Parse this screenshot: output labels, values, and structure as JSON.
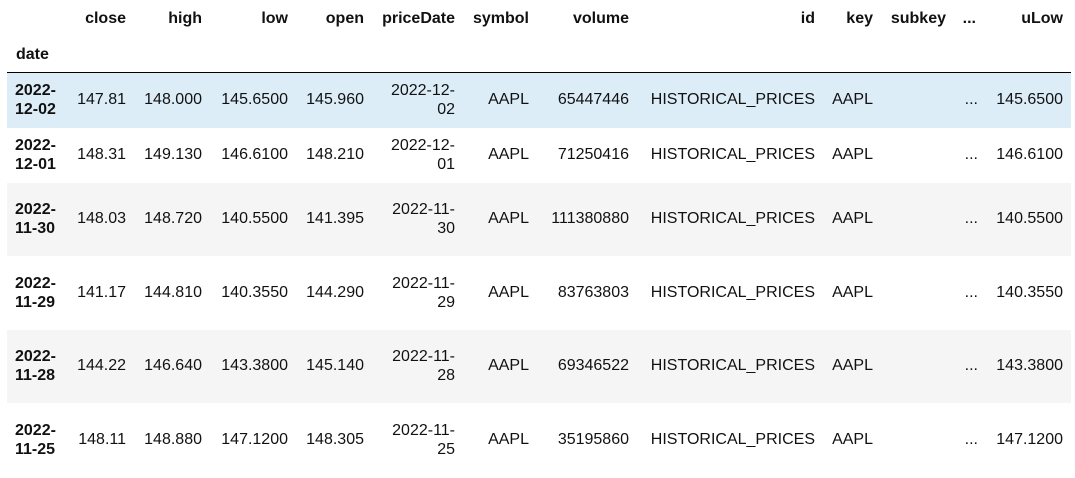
{
  "columns": [
    "close",
    "high",
    "low",
    "open",
    "priceDate",
    "symbol",
    "volume",
    "id",
    "key",
    "subkey",
    "...",
    "uLow"
  ],
  "index_name": "date",
  "rows": [
    {
      "date": "2022-12-02",
      "close": "147.81",
      "high": "148.000",
      "low": "145.6500",
      "open": "145.960",
      "priceDate": "2022-12-02",
      "symbol": "AAPL",
      "volume": "65447446",
      "id": "HISTORICAL_PRICES",
      "key": "AAPL",
      "subkey": "",
      "dots": "...",
      "uLow": "145.6500"
    },
    {
      "date": "2022-12-01",
      "close": "148.31",
      "high": "149.130",
      "low": "146.6100",
      "open": "148.210",
      "priceDate": "2022-12-01",
      "symbol": "AAPL",
      "volume": "71250416",
      "id": "HISTORICAL_PRICES",
      "key": "AAPL",
      "subkey": "",
      "dots": "...",
      "uLow": "146.6100"
    },
    {
      "date": "2022-11-30",
      "close": "148.03",
      "high": "148.720",
      "low": "140.5500",
      "open": "141.395",
      "priceDate": "2022-11-30",
      "symbol": "AAPL",
      "volume": "111380880",
      "id": "HISTORICAL_PRICES",
      "key": "AAPL",
      "subkey": "",
      "dots": "...",
      "uLow": "140.5500"
    },
    {
      "date": "2022-11-29",
      "close": "141.17",
      "high": "144.810",
      "low": "140.3550",
      "open": "144.290",
      "priceDate": "2022-11-29",
      "symbol": "AAPL",
      "volume": "83763803",
      "id": "HISTORICAL_PRICES",
      "key": "AAPL",
      "subkey": "",
      "dots": "...",
      "uLow": "140.3550"
    },
    {
      "date": "2022-11-28",
      "close": "144.22",
      "high": "146.640",
      "low": "143.3800",
      "open": "145.140",
      "priceDate": "2022-11-28",
      "symbol": "AAPL",
      "volume": "69346522",
      "id": "HISTORICAL_PRICES",
      "key": "AAPL",
      "subkey": "",
      "dots": "...",
      "uLow": "143.3800"
    },
    {
      "date": "2022-11-25",
      "close": "148.11",
      "high": "148.880",
      "low": "147.1200",
      "open": "148.305",
      "priceDate": "2022-11-25",
      "symbol": "AAPL",
      "volume": "35195860",
      "id": "HISTORICAL_PRICES",
      "key": "AAPL",
      "subkey": "",
      "dots": "...",
      "uLow": "147.1200"
    }
  ],
  "colors": {
    "selected_row": "#dcedf8",
    "striped_row": "#f5f5f5"
  }
}
